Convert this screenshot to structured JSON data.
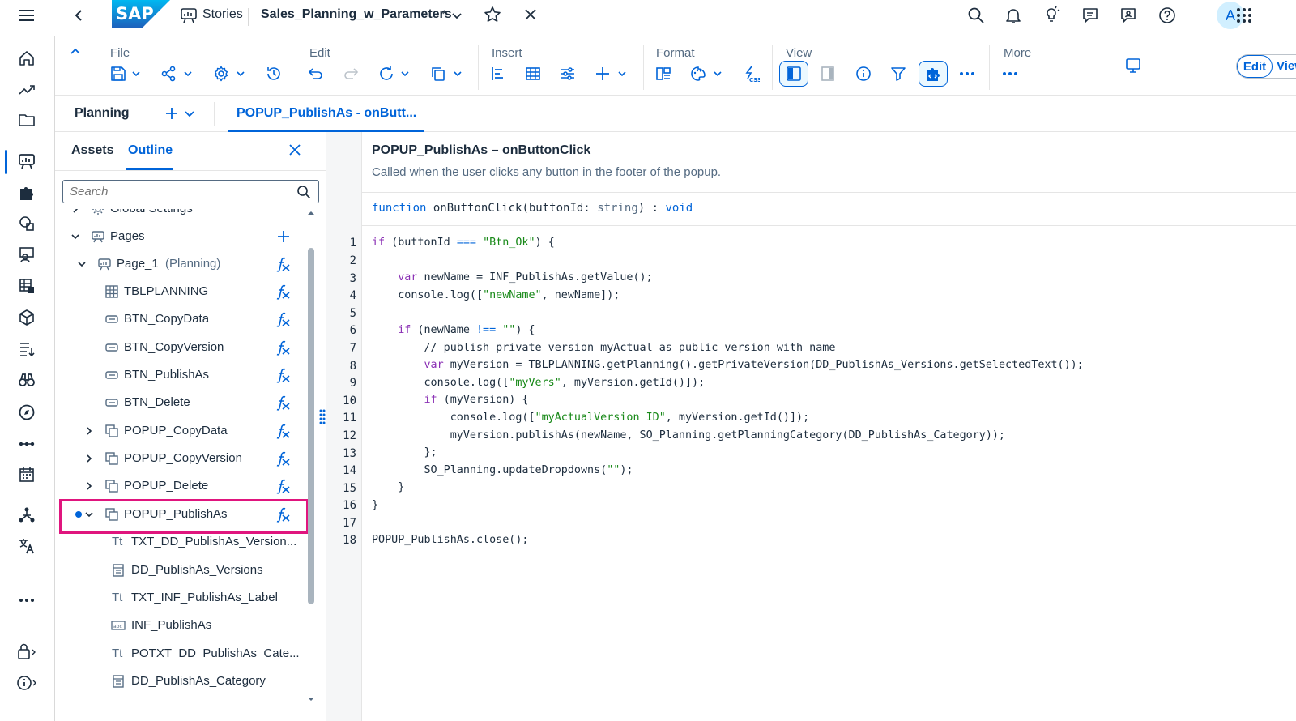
{
  "shell": {
    "stories_label": "Stories",
    "story_title": "Sales_Planning_w_Parameters",
    "modified_marker": "*",
    "avatar_initial": "A"
  },
  "toolbar": {
    "groups": {
      "file": "File",
      "edit": "Edit",
      "insert": "Insert",
      "format": "Format",
      "view": "View",
      "more": "More"
    },
    "edit_label": "Edit",
    "view_label": "View"
  },
  "tabs": {
    "planning_label": "Planning",
    "script_tab_label": "POPUP_PublishAs - onButt..."
  },
  "outline_panel": {
    "tab_assets": "Assets",
    "tab_outline": "Outline",
    "search_placeholder": "Search",
    "tree": [
      {
        "label": "Global Settings",
        "icon": "settings-icon"
      },
      {
        "label": "Pages",
        "icon": "page-icon"
      },
      {
        "label": "Page_1",
        "sublabel": "(Planning)",
        "icon": "page-icon"
      },
      {
        "label": "TBLPLANNING",
        "icon": "table-icon"
      },
      {
        "label": "BTN_CopyData",
        "icon": "button-icon"
      },
      {
        "label": "BTN_CopyVersion",
        "icon": "button-icon"
      },
      {
        "label": "BTN_PublishAs",
        "icon": "button-icon"
      },
      {
        "label": "BTN_Delete",
        "icon": "button-icon"
      },
      {
        "label": "POPUP_CopyData",
        "icon": "popup-icon"
      },
      {
        "label": "POPUP_CopyVersion",
        "icon": "popup-icon"
      },
      {
        "label": "POPUP_Delete",
        "icon": "popup-icon"
      },
      {
        "label": "POPUP_PublishAs",
        "icon": "popup-icon"
      },
      {
        "label": "TXT_DD_PublishAs_Version...",
        "icon": "text-icon"
      },
      {
        "label": "DD_PublishAs_Versions",
        "icon": "dropdown-icon"
      },
      {
        "label": "TXT_INF_PublishAs_Label",
        "icon": "text-icon"
      },
      {
        "label": "INF_PublishAs",
        "icon": "input-field-icon"
      },
      {
        "label": "POTXT_DD_PublishAs_Cate...",
        "icon": "text-icon"
      },
      {
        "label": "DD_PublishAs_Category",
        "icon": "dropdown-icon"
      }
    ],
    "text_icon_glyph": "Tt"
  },
  "editor": {
    "title": "POPUP_PublishAs – onButtonClick",
    "description": "Called when the user clicks any button in the footer of the popup.",
    "signature": {
      "kw_function": "function",
      "name": "onButtonClick(buttonId:",
      "param_type": "string",
      "close": ") :",
      "return_type": "void"
    },
    "line_numbers": [
      "1",
      "2",
      "3",
      "4",
      "5",
      "6",
      "7",
      "8",
      "9",
      "10",
      "11",
      "12",
      "13",
      "14",
      "15",
      "16",
      "17",
      "18"
    ],
    "lines": {
      "l1": {
        "a": "if",
        "b": " (buttonId ",
        "c": "===",
        "d": " ",
        "e": "\"Btn_Ok\"",
        "f": ") {"
      },
      "l3": {
        "a": "    var",
        "b": " newName = INF_PublishAs.getValue();"
      },
      "l4": {
        "a": "    console.log([",
        "b": "\"newName\"",
        "c": ", newName]);"
      },
      "l6": {
        "a": "    if",
        "b": " (newName ",
        "c": "!==",
        "d": " ",
        "e": "\"\"",
        "f": ") {"
      },
      "l7": {
        "a": "        // publish private version myActual as public version with name"
      },
      "l8": {
        "a": "        var",
        "b": " myVersion = TBLPLANNING.getPlanning().getPrivateVersion(DD_PublishAs_Versions.getSelectedText());"
      },
      "l9": {
        "a": "        console.log([",
        "b": "\"myVers\"",
        "c": ", myVersion.getId()]);"
      },
      "l10": {
        "a": "        if",
        "b": " (myVersion) {"
      },
      "l11": {
        "a": "            console.log([",
        "b": "\"myActualVersion ID\"",
        "c": ", myVersion.getId()]);"
      },
      "l12": {
        "a": "            myVersion.publishAs(newName, SO_Planning.getPlanningCategory(DD_PublishAs_Category));"
      },
      "l13": {
        "a": "        };"
      },
      "l14": {
        "a": "        SO_Planning.updateDropdowns(",
        "b": "\"\"",
        "c": ");"
      },
      "l15": {
        "a": "    }"
      },
      "l16": {
        "a": "}"
      },
      "l18": {
        "a": "POPUP_PublishAs.close();"
      }
    }
  },
  "colors": {
    "accent": "#0064d9",
    "highlight_border": "#e0157e",
    "sap_logo_blue": "#0a6ed1"
  }
}
